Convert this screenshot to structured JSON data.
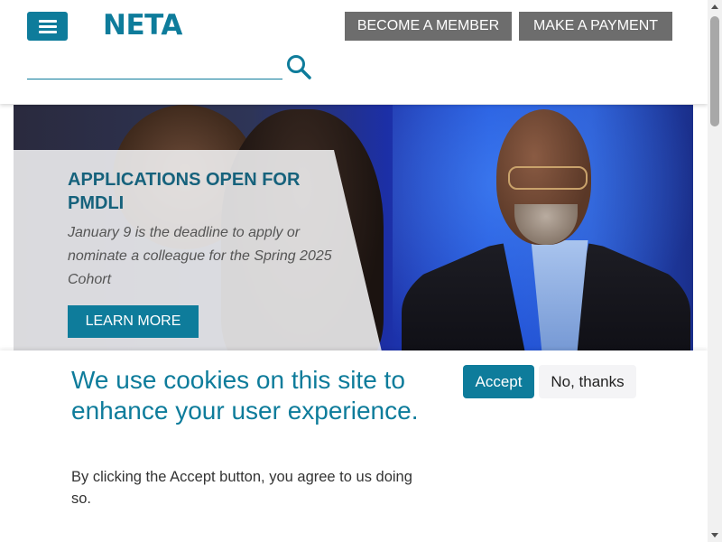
{
  "header": {
    "logo_text": "NETA",
    "become_member_label": "BECOME A MEMBER",
    "make_payment_label": "MAKE A PAYMENT",
    "search": {
      "value": "",
      "placeholder": ""
    }
  },
  "hero": {
    "title": "APPLICATIONS OPEN FOR PMDLI",
    "text": "January 9 is the deadline to apply or nominate a colleague for the Spring 2025 Cohort",
    "button_label": "LEARN MORE"
  },
  "cookie_banner": {
    "title": "We use cookies on this site to enhance your user experience.",
    "text": "By clicking the Accept button, you agree to us doing so.",
    "accept_label": "Accept",
    "decline_label": "No, thanks"
  },
  "colors": {
    "brand": "#0e7c9b",
    "header_button": "#6d6d6d"
  },
  "icons": [
    "menu-icon",
    "search-icon",
    "scroll-up-icon",
    "scroll-down-icon"
  ]
}
